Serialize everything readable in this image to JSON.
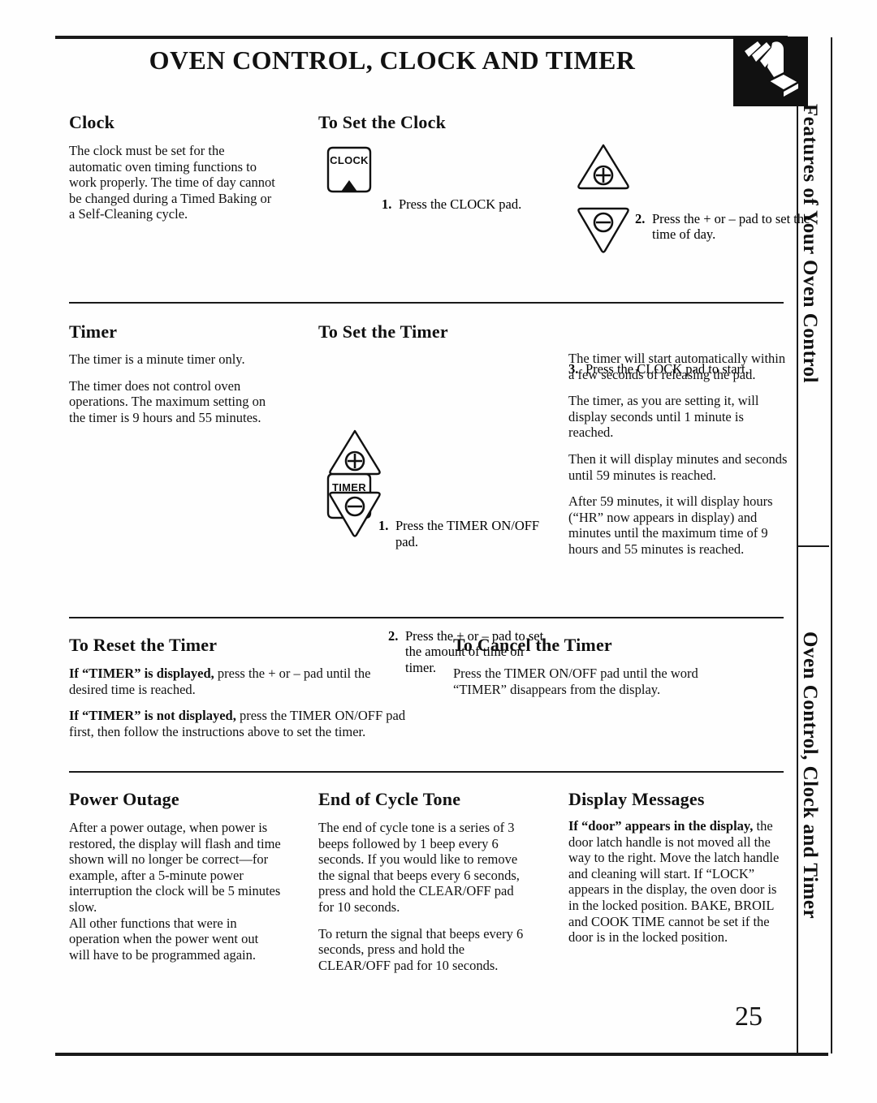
{
  "page": {
    "title": "OVEN CONTROL, CLOCK AND TIMER",
    "number": "25",
    "header_icon": "hand-pressing-pad-icon"
  },
  "side_tabs": [
    {
      "label": "Features of Your Oven Control"
    },
    {
      "label": "Oven Control, Clock and Timer"
    }
  ],
  "sections": {
    "clock": {
      "heading": "Clock",
      "body": "The clock must be set for the automatic oven timing functions to work properly. The time of day cannot be changed during a Timed Baking or a Self-Cleaning cycle."
    },
    "set_clock": {
      "heading": "To Set the Clock",
      "pad": {
        "label": "CLOCK",
        "name": "clock-pad"
      },
      "steps": [
        {
          "num": "1.",
          "text": "Press the CLOCK pad."
        },
        {
          "num": "2.",
          "text": "Press the + or – pad to set the time of day."
        },
        {
          "num": "3.",
          "text": "Press the CLOCK pad to start."
        }
      ],
      "plus_pad": "plus-pad",
      "minus_pad": "minus-pad"
    },
    "timer": {
      "heading": "Timer",
      "paragraphs": [
        "The timer is a minute timer only.",
        "The timer does not control oven operations. The maximum setting on the timer is 9 hours and 55 minutes."
      ]
    },
    "set_timer": {
      "heading": "To Set the Timer",
      "pad": {
        "label_line1": "TIMER",
        "label_line2": "ON/OFF",
        "name": "timer-on-off-pad"
      },
      "steps": [
        {
          "num": "1.",
          "text": "Press the TIMER ON/OFF pad."
        },
        {
          "num": "2.",
          "text": "Press the + or – pad to set the amount of time on timer."
        }
      ],
      "notes": [
        "The timer will start automatically within a few seconds of releasing the pad.",
        "The timer, as you are setting it, will display seconds until 1 minute is reached.",
        "Then it will display minutes and seconds until 59 minutes is reached.",
        "After 59 minutes, it will display hours (“HR” now appears in display) and minutes until the maximum time of 9 hours and 55 minutes is reached."
      ]
    },
    "reset_timer": {
      "heading": "To Reset the Timer",
      "para1_bold": "If “TIMER” is displayed,",
      "para1_rest": " press the + or – pad until the desired time is reached.",
      "para2_bold": "If “TIMER” is not displayed,",
      "para2_rest": " press the TIMER ON/OFF pad first, then follow the instructions above to set the timer."
    },
    "cancel_timer": {
      "heading": "To Cancel the Timer",
      "body": "Press the TIMER ON/OFF pad until the word “TIMER” disappears from the display."
    },
    "power_outage": {
      "heading": "Power Outage",
      "paragraphs": [
        "After a power outage, when power is restored, the display will flash and time shown will no longer be correct—for example, after a 5-minute power interruption the clock will be 5 minutes slow.",
        "All other functions that were in operation when the power went out will have to be programmed again."
      ]
    },
    "end_of_cycle_tone": {
      "heading": "End of Cycle Tone",
      "paragraphs": [
        "The end of cycle tone is a series of 3 beeps followed by 1 beep every 6 seconds. If you would like to remove the signal that beeps every 6 seconds, press and hold the CLEAR/OFF pad for 10 seconds.",
        "To return the signal that beeps every 6 seconds, press and hold the CLEAR/OFF pad for 10 seconds."
      ]
    },
    "display_messages": {
      "heading": "Display Messages",
      "body_bold": "If “door” appears in the display,",
      "body_rest": " the door latch handle is not moved all the way to the right. Move the latch handle and cleaning will start. If “LOCK” appears in the display, the oven door is in the locked position. BAKE, BROIL and COOK TIME cannot be set if the door is in the locked position."
    }
  },
  "colors": {
    "ink": "#111111",
    "paper": "#ffffff"
  }
}
